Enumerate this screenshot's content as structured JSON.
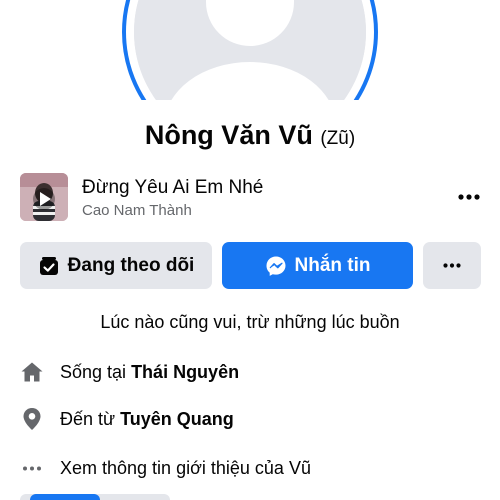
{
  "profile": {
    "name": "Nông Văn Vũ",
    "alternate_name": "(Zũ)"
  },
  "music": {
    "title": "Đừng Yêu Ai Em Nhé",
    "artist": "Cao Nam Thành"
  },
  "actions": {
    "follow_label": "Đang theo dõi",
    "message_label": "Nhắn tin"
  },
  "bio": "Lúc nào cũng vui, trừ những lúc buồn",
  "details": {
    "lives_prefix": "Sống tại",
    "lives_place": "Thái Nguyên",
    "from_prefix": "Đến từ",
    "from_place": "Tuyên Quang",
    "about_link": "Xem thông tin giới thiệu của Vũ"
  },
  "colors": {
    "accent": "#1877f2",
    "button_gray": "#e4e6eb",
    "secondary_text": "#65676b",
    "icon_gray": "#65676b"
  },
  "icons": [
    "home-icon",
    "location-pin-icon",
    "more-dots-icon",
    "messenger-icon",
    "following-check-icon",
    "play-icon"
  ]
}
